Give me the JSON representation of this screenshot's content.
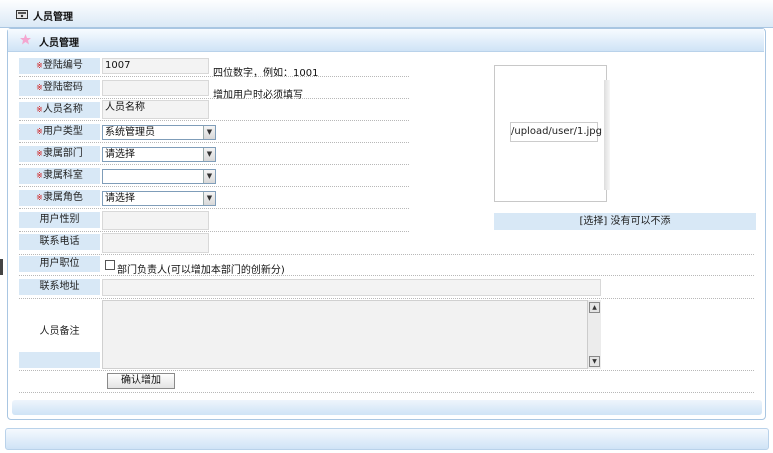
{
  "window": {
    "title": "人员管理"
  },
  "panel": {
    "title": "人员管理"
  },
  "form": {
    "required_mark": "※",
    "fields": {
      "login_no": {
        "label": "登陆编号",
        "value": "1007",
        "hint": "四位数字，例如：1001"
      },
      "login_pwd": {
        "label": "登陆密码",
        "value": "",
        "hint": "增加用户时必须填写"
      },
      "person_name": {
        "label": "人员名称",
        "value": "人员名称"
      },
      "user_type": {
        "label": "用户类型",
        "selected": "系统管理员"
      },
      "department": {
        "label": "隶属部门",
        "selected": "请选择"
      },
      "section": {
        "label": "隶属科室",
        "selected": ""
      },
      "role": {
        "label": "隶属角色",
        "selected": "请选择"
      },
      "gender": {
        "label": "用户性别",
        "value": ""
      },
      "phone": {
        "label": "联系电话",
        "value": ""
      },
      "position": {
        "label": "用户职位",
        "checkbox_label": "部门负责人(可以增加本部门的创新分)",
        "checked": false
      },
      "address": {
        "label": "联系地址",
        "value": ""
      },
      "remark": {
        "label": "人员备注",
        "value": ""
      }
    },
    "photo": {
      "path": "/upload/user/1.jpg",
      "choose_text": "[选择] 没有可以不添"
    },
    "submit_label": "确认增加"
  },
  "icons": {
    "window": "app-window-icon",
    "panel": "star-icon"
  },
  "colors": {
    "label_bg": "#d8e8f6",
    "required": "#d01818",
    "header_grad": "#cfe3f6"
  }
}
